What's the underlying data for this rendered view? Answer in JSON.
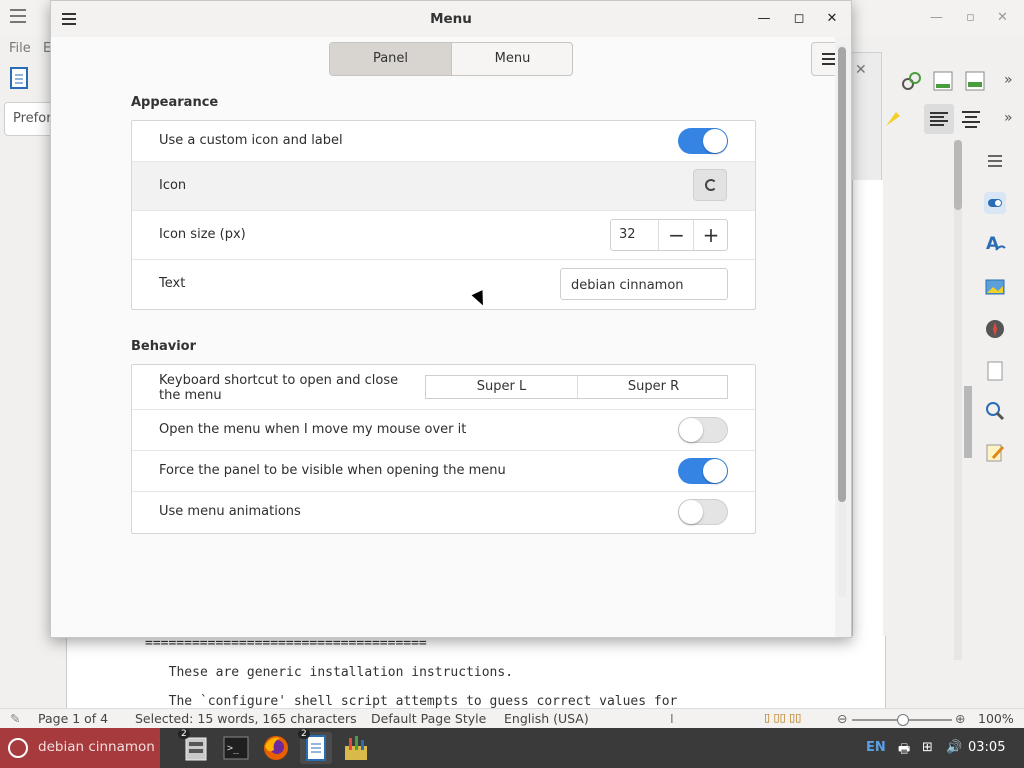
{
  "background_app": {
    "menu_file": "File",
    "menu_edit": "E",
    "paragraph_style": "Preformatted Text",
    "doc_lines": [
      "====================================",
      "  These are generic installation instructions.",
      "  The `configure' shell script attempts to guess correct values for"
    ],
    "status": {
      "page": "Page 1 of 4",
      "selection": "Selected: 15 words, 165 characters",
      "page_style": "Default Page Style",
      "language": "English (USA)",
      "zoom": "100%"
    }
  },
  "dialog": {
    "title": "Menu",
    "tabs": [
      {
        "label": "Panel",
        "active": true
      },
      {
        "label": "Menu",
        "active": false
      }
    ],
    "appearance": {
      "heading": "Appearance",
      "custom_icon_label": "Use a custom icon and label",
      "custom_icon_enabled": true,
      "icon_label": "Icon",
      "icon_size_label": "Icon size (px)",
      "icon_size_value": "32",
      "text_label": "Text",
      "text_value": "debian cinnamon"
    },
    "behavior": {
      "heading": "Behavior",
      "shortcut_label": "Keyboard shortcut to open and close the menu",
      "shortcut_primary": "Super L",
      "shortcut_secondary": "Super R",
      "hover_open_label": "Open the menu when I move my mouse over it",
      "hover_open_enabled": false,
      "force_panel_label": "Force the panel to be visible when opening the menu",
      "force_panel_enabled": true,
      "animations_label": "Use menu animations",
      "animations_enabled": false
    }
  },
  "taskbar": {
    "start_label": "debian cinnamon",
    "file_manager_badge": "2",
    "writer_badge": "2",
    "keyboard_layout": "EN",
    "clock": "03:05"
  },
  "colors": {
    "accent": "#3584e4",
    "start_button": "#a63a3c",
    "taskbar": "#3a3a3a"
  }
}
